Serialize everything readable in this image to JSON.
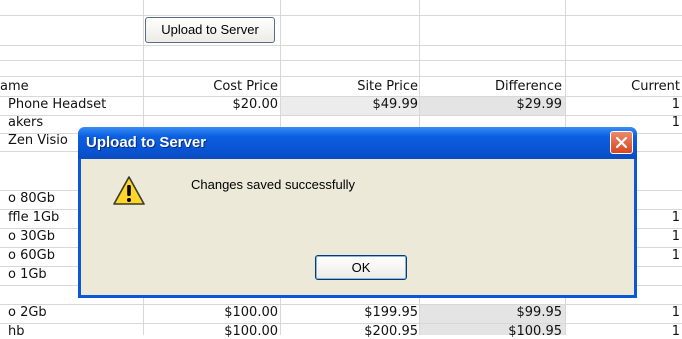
{
  "toolbar": {
    "upload_label": "Upload to Server"
  },
  "table": {
    "headers": [
      "ame",
      "Cost Price",
      "Site Price",
      "Difference",
      "Current"
    ],
    "rows": [
      {
        "name": "Phone Headset",
        "cost": "$20.00",
        "site": "$49.99",
        "diff": "$29.99",
        "cur": "1"
      },
      {
        "name": "akers",
        "cost": "",
        "site": "",
        "diff": "",
        "cur": "1"
      },
      {
        "name": "Zen Visio",
        "cost": "",
        "site": "",
        "diff": "",
        "cur": ""
      },
      {
        "name": "",
        "cost": "",
        "site": "",
        "diff": "",
        "cur": ""
      },
      {
        "name": "o 80Gb",
        "cost": "",
        "site": "",
        "diff": "",
        "cur": ""
      },
      {
        "name": "ffle 1Gb",
        "cost": "",
        "site": "",
        "diff": "",
        "cur": "1"
      },
      {
        "name": "o 30Gb",
        "cost": "",
        "site": "",
        "diff": "",
        "cur": "1"
      },
      {
        "name": "o 60Gb",
        "cost": "",
        "site": "",
        "diff": "",
        "cur": "1"
      },
      {
        "name": "o 1Gb",
        "cost": "",
        "site": "",
        "diff": "",
        "cur": ""
      },
      {
        "name": "o 2Gb",
        "cost": "$100.00",
        "site": "$199.95",
        "diff": "$99.95",
        "cur": "1"
      },
      {
        "name": "hb",
        "cost": "$100.00",
        "site": "$200.95",
        "diff": "$100.95",
        "cur": "1"
      }
    ]
  },
  "dialog": {
    "title": "Upload to Server",
    "message": "Changes saved successfully",
    "ok_label": "OK",
    "icon": "warning-icon"
  },
  "colors": {
    "titlebar": "#0a5fe0",
    "dialog_bg": "#ece9d8",
    "close_button": "#d9461f"
  }
}
